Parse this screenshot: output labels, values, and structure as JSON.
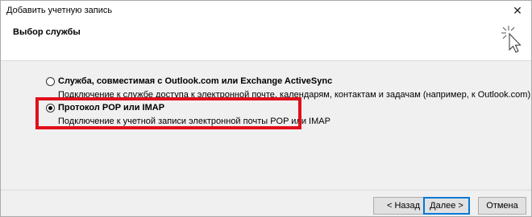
{
  "window": {
    "title": "Добавить учетную запись",
    "close_symbol": "✕"
  },
  "header": {
    "title": "Выбор службы",
    "icon": "cursor-click-icon"
  },
  "options": [
    {
      "label": "Служба, совместимая с Outlook.com или Exchange ActiveSync",
      "description": "Подключение к службе доступа к электронной почте, календарям, контактам и задачам (например, к Outlook.com)",
      "selected": false
    },
    {
      "label": "Протокол POP или IMAP",
      "description": "Подключение к учетной записи электронной почты POP или IMAP",
      "selected": true
    }
  ],
  "highlight_color": "#e0101a",
  "buttons": {
    "back": "< Назад",
    "next": "Далее >",
    "cancel": "Отмена"
  }
}
